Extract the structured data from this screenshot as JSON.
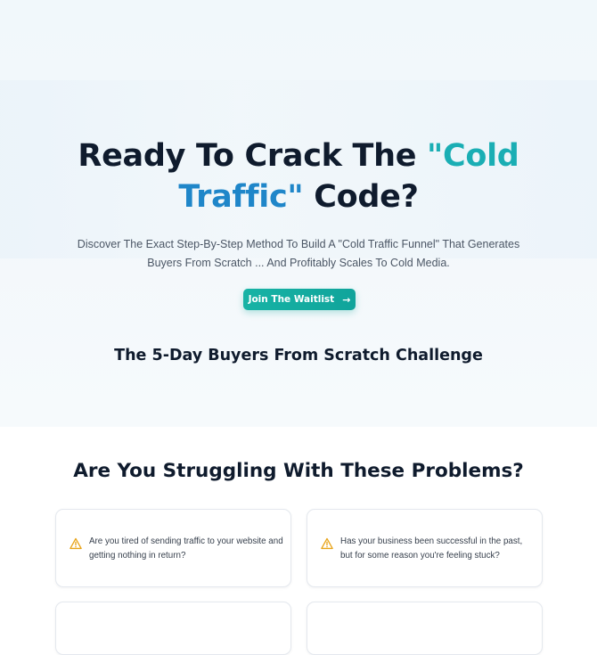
{
  "hero": {
    "title_part1": "Ready To Crack The ",
    "title_highlight_1": "\"Cold",
    "title_highlight_2": "Traffic\"",
    "title_part2": " Code?",
    "description": "Discover The Exact Step-By-Step Method To Build A \"Cold Traffic Funnel\" That Generates Buyers From Scratch ... And Profitably Scales To Cold Media.",
    "cta_label": "Join The Waitlist",
    "cta_icon": "arrow-right-icon",
    "challenge_title": "The 5-Day Buyers From Scratch Challenge"
  },
  "problems": {
    "title": "Are You Struggling With These Problems?",
    "items": [
      {
        "icon": "warning-icon",
        "text": "Are you tired of sending traffic to your website and getting nothing in return?"
      },
      {
        "icon": "warning-icon",
        "text": "Has your business been successful in the past, but for some reason you're feeling stuck?"
      }
    ]
  },
  "colors": {
    "heading": "#0f1b2d",
    "accent_teal": "#1aaeb4",
    "accent_blue": "#1f86c9",
    "button": "#10a49b",
    "warning": "#e8a317"
  }
}
